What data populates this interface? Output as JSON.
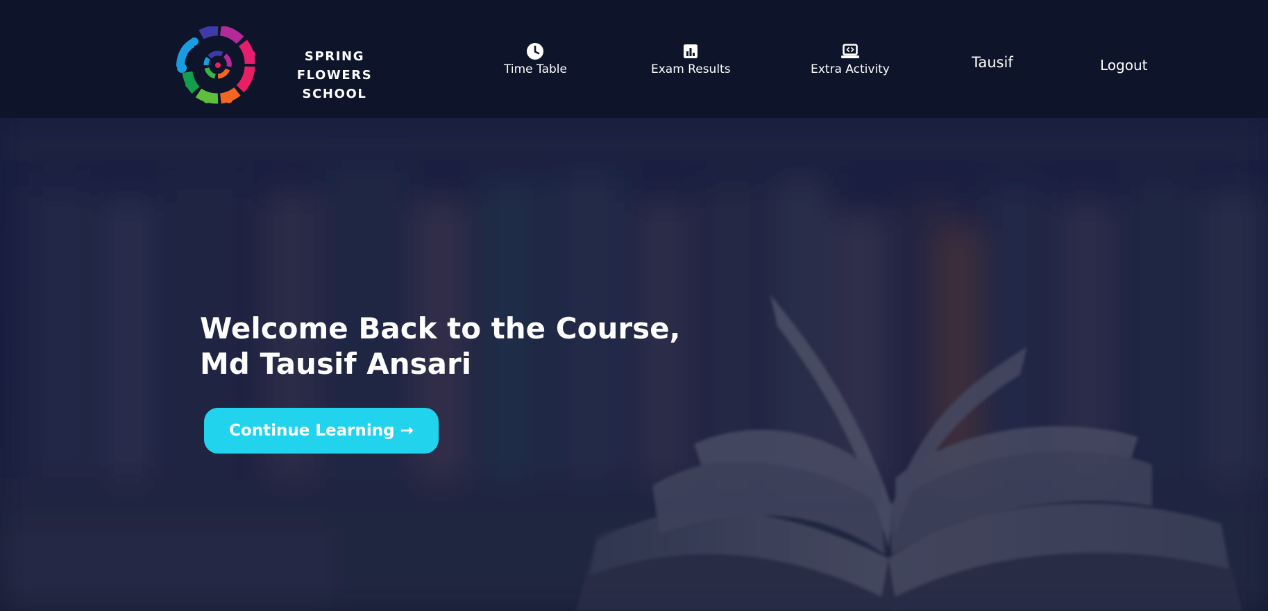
{
  "header": {
    "logo": {
      "line1": "SPRING FLOWERS",
      "line2": "SCHOOL"
    },
    "nav": [
      {
        "label": "Time Table",
        "icon": "clock-icon"
      },
      {
        "label": "Exam Results",
        "icon": "bar-chart-icon"
      },
      {
        "label": "Extra Activity",
        "icon": "laptop-code-icon"
      }
    ],
    "user_name": "Tausif",
    "logout_label": "Logout"
  },
  "hero": {
    "title_line1": "Welcome Back to the Course,",
    "title_line2": "Md Tausif Ansari",
    "cta_label": "Continue Learning →"
  },
  "colors": {
    "header_bg": "#0e152b",
    "cta_bg": "#22d3ee",
    "text": "#ffffff",
    "logo_palette": [
      "#2e2a8f",
      "#c0269a",
      "#e91e63",
      "#f26522",
      "#39b54a",
      "#0fa14a",
      "#1a9de0",
      "#3e3aa8"
    ]
  }
}
